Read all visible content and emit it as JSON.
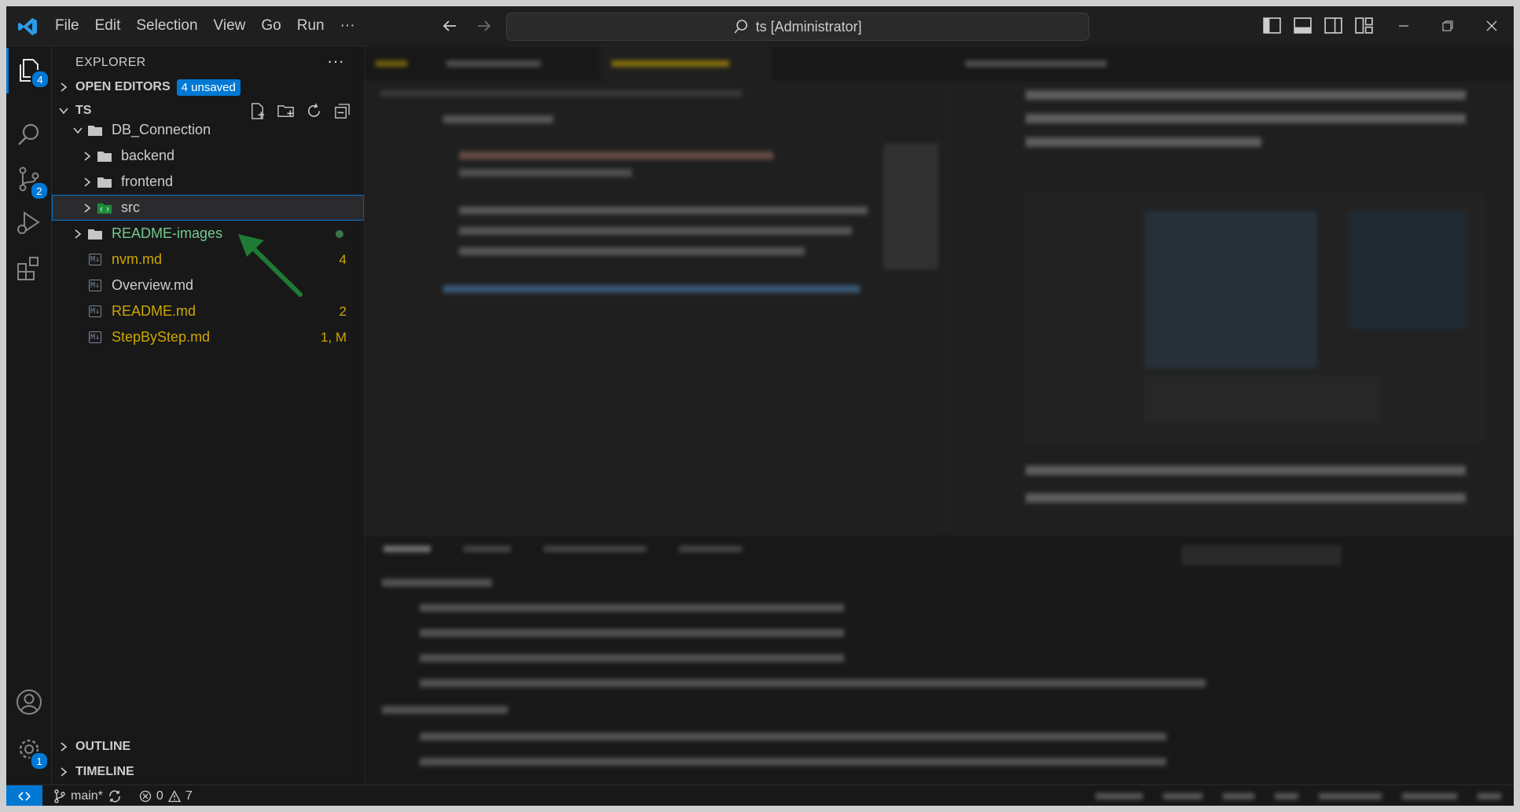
{
  "window": {
    "search_text": "ts [Administrator]",
    "menu": [
      "File",
      "Edit",
      "Selection",
      "View",
      "Go",
      "Run",
      "···"
    ]
  },
  "activity": {
    "explorer_badge": "4",
    "scm_badge": "2",
    "settings_badge": "1"
  },
  "sidebar": {
    "title": "EXPLORER",
    "more": "···",
    "open_editors_label": "OPEN EDITORS",
    "unsaved_badge": "4 unsaved",
    "root_folder": "TS",
    "tree": [
      {
        "label": "DB_Connection",
        "type": "folder",
        "expanded": true,
        "color": "#cccccc"
      },
      {
        "label": "backend",
        "type": "folder",
        "color": "#cccccc"
      },
      {
        "label": "frontend",
        "type": "folder",
        "color": "#cccccc"
      },
      {
        "label": "src",
        "type": "folder",
        "color": "#cccccc",
        "selected": true
      },
      {
        "label": "README-images",
        "type": "folder",
        "color": "#73c991"
      },
      {
        "label": "nvm.md",
        "type": "file",
        "badge": "4",
        "color": "#cca700"
      },
      {
        "label": "Overview.md",
        "type": "file",
        "color": "#cccccc"
      },
      {
        "label": "README.md",
        "type": "file",
        "badge": "2",
        "color": "#cca700"
      },
      {
        "label": "StepByStep.md",
        "type": "file",
        "badge": "1, M",
        "color": "#cca700"
      }
    ],
    "outline_label": "OUTLINE",
    "timeline_label": "TIMELINE"
  },
  "statusbar": {
    "branch": "main*",
    "errors": "0",
    "warnings": "7"
  },
  "colors": {
    "accent": "#0078d4",
    "annotation_arrow": "#1e7a34"
  }
}
